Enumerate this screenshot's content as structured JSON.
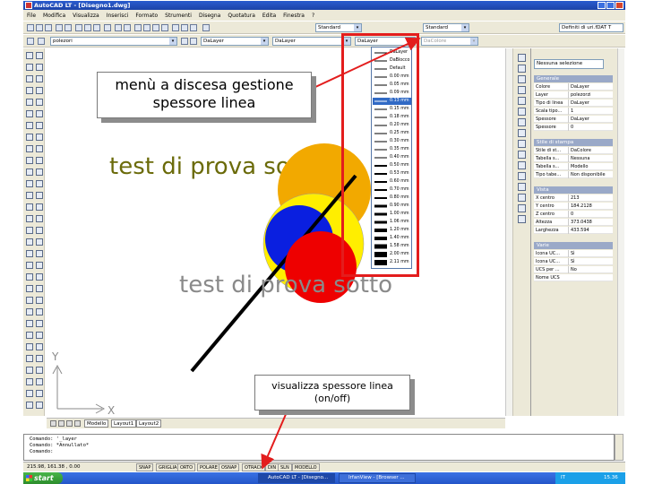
{
  "window": {
    "title": "AutoCAD LT - [Disegno1.dwg]"
  },
  "menu": [
    "File",
    "Modifica",
    "Visualizza",
    "Inserisci",
    "Formato",
    "Strumenti",
    "Disegna",
    "Quotatura",
    "Edita",
    "Finestra",
    "?"
  ],
  "toolbar1": {
    "text_style": "Standard",
    "dim_style": "Standard",
    "right_field": "Definiti di uri.fDAT T"
  },
  "toolbar2": {
    "layer": "polezori",
    "color": "DaLayer",
    "linetype": "DaLayer",
    "lineweight": "DaLayer",
    "plotstyle": "DaColore"
  },
  "lineweight_list": [
    "DaLayer",
    "DaBlocco",
    "Default",
    "0.00 mm",
    "0.05 mm",
    "0.09 mm",
    "0.13 mm",
    "0.15 mm",
    "0.18 mm",
    "0.20 mm",
    "0.25 mm",
    "0.30 mm",
    "0.35 mm",
    "0.40 mm",
    "0.50 mm",
    "0.53 mm",
    "0.60 mm",
    "0.70 mm",
    "0.80 mm",
    "0.90 mm",
    "1.00 mm",
    "1.06 mm",
    "1.20 mm",
    "1.40 mm",
    "1.58 mm",
    "2.00 mm",
    "2.11 mm"
  ],
  "lineweight_highlighted": "0.13 mm",
  "canvas": {
    "text_top": "test di prova sopra",
    "text_bottom": "test di prova sotto",
    "ucs_y": "Y",
    "ucs_x": "X"
  },
  "layout_tabs": [
    "Modello",
    "Layout1",
    "Layout2"
  ],
  "properties": {
    "selection": "Nessuna selezione",
    "sections": [
      {
        "title": "Generale",
        "rows": [
          {
            "key": "Colore",
            "value": "DaLayer"
          },
          {
            "key": "Layer",
            "value": "polezorzi"
          },
          {
            "key": "Tipo di linea",
            "value": "DaLayer"
          },
          {
            "key": "Scala tipo...",
            "value": "1"
          },
          {
            "key": "Spessore",
            "value": "DaLayer"
          },
          {
            "key": "Spessore",
            "value": "0"
          }
        ]
      },
      {
        "title": "Stile di stampa",
        "rows": [
          {
            "key": "Stile di st...",
            "value": "DaColore"
          },
          {
            "key": "Tabella s...",
            "value": "Nessuna"
          },
          {
            "key": "Tabella s...",
            "value": "Modello"
          },
          {
            "key": "Tipo tabe...",
            "value": "Non disponibile"
          }
        ]
      },
      {
        "title": "Vista",
        "rows": [
          {
            "key": "X centro",
            "value": "213"
          },
          {
            "key": "Y centro",
            "value": "184.2128"
          },
          {
            "key": "Z centro",
            "value": "0"
          },
          {
            "key": "Altezza",
            "value": "373.0438"
          },
          {
            "key": "Larghezza",
            "value": "433.594"
          }
        ]
      },
      {
        "title": "Varie",
        "rows": [
          {
            "key": "Icona UC...",
            "value": "Sì"
          },
          {
            "key": "Icona UC...",
            "value": "Sì"
          },
          {
            "key": "UCS per ...",
            "value": "No"
          },
          {
            "key": "Nome UCS",
            "value": ""
          }
        ]
      }
    ]
  },
  "command_lines": [
    "Comando: '_layer",
    "Comando: *Annullato*",
    "Comando:"
  ],
  "status": {
    "coords": "215.98, 161.38 , 0.00",
    "buttons": [
      "SNAP",
      "GRIGLIA",
      "ORTO",
      "POLARE",
      "OSNAP",
      "OTRACK",
      "DIN",
      "SLN",
      "MODELLO"
    ]
  },
  "taskbar": {
    "start": "start",
    "tasks": [
      "AutoCAD LT - [Disegno...",
      "IrfanView - [Browser ..."
    ],
    "tray_lang": "IT",
    "clock": "15.36"
  },
  "callouts": {
    "lineweight_menu": "menù a discesa gestione spessore linea",
    "lwt_toggle": "visualizza spessore linea (on/off)"
  },
  "colors": {
    "annotation_red": "#e31d1d",
    "circle_orange": "#f2a900",
    "circle_yellow": "#ffee00",
    "circle_blue": "#0a1fe0",
    "circle_red": "#ee0000",
    "canvas_text": "#6b6b0a"
  }
}
